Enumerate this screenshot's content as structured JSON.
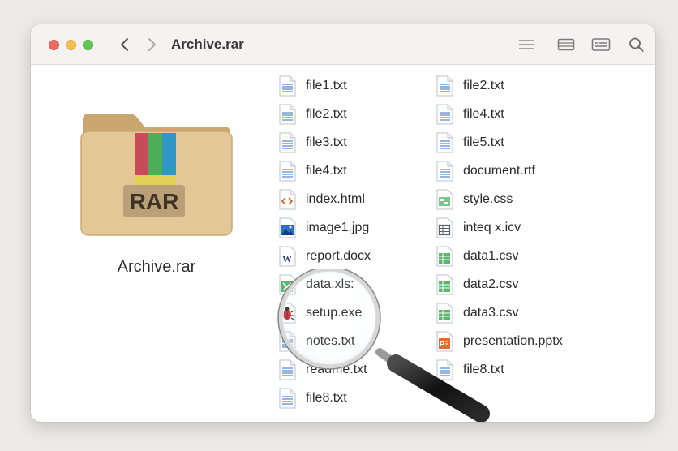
{
  "window": {
    "title": "Archive.rar",
    "accent_colors": {
      "close": "#ee6a5f",
      "minimize": "#f5be4f",
      "zoom": "#61c554"
    }
  },
  "toolbar": {
    "back_icon": "chevron-left-icon",
    "forward_icon": "chevron-right-icon",
    "view_buttons": [
      "list-view-icon",
      "columns-view-icon",
      "gallery-view-icon"
    ],
    "search_icon": "search-icon"
  },
  "archive": {
    "name": "Archive.rar",
    "badge": "RAR",
    "icon": "rar-folder-icon"
  },
  "files_left": [
    {
      "name": "file1.txt",
      "icon": "text-file-icon"
    },
    {
      "name": "file2.txt",
      "icon": "text-file-icon"
    },
    {
      "name": "file3.txt",
      "icon": "text-file-icon"
    },
    {
      "name": "file4.txt",
      "icon": "text-file-icon"
    },
    {
      "name": "index.html",
      "icon": "html-file-icon"
    },
    {
      "name": "image1.jpg",
      "icon": "image-file-icon"
    },
    {
      "name": "report.docx",
      "icon": "word-file-icon"
    },
    {
      "name": "data.xls:",
      "icon": "excel-file-icon"
    },
    {
      "name": "setup.exe",
      "icon": "malware-file-icon"
    },
    {
      "name": "notes.txt",
      "icon": "text-file-icon"
    },
    {
      "name": "readme.txt",
      "icon": "text-file-icon"
    },
    {
      "name": "file8.txt",
      "icon": "text-file-icon"
    }
  ],
  "files_right": [
    {
      "name": "file2.txt",
      "icon": "text-file-icon"
    },
    {
      "name": "file4.txt",
      "icon": "text-file-icon"
    },
    {
      "name": "file5.txt",
      "icon": "text-file-icon"
    },
    {
      "name": "document.rtf",
      "icon": "text-file-icon"
    },
    {
      "name": "style.css",
      "icon": "css-file-icon"
    },
    {
      "name": "inteq x.icv",
      "icon": "table-file-icon"
    },
    {
      "name": "data1.csv",
      "icon": "csv-file-icon"
    },
    {
      "name": "data2.csv",
      "icon": "csv-file-icon"
    },
    {
      "name": "data3.csv",
      "icon": "csv-file-icon"
    },
    {
      "name": "presentation.pptx",
      "icon": "powerpoint-file-icon"
    },
    {
      "name": "file8.txt",
      "icon": "text-file-icon"
    }
  ],
  "overlay": {
    "icon": "magnifying-glass-icon"
  }
}
